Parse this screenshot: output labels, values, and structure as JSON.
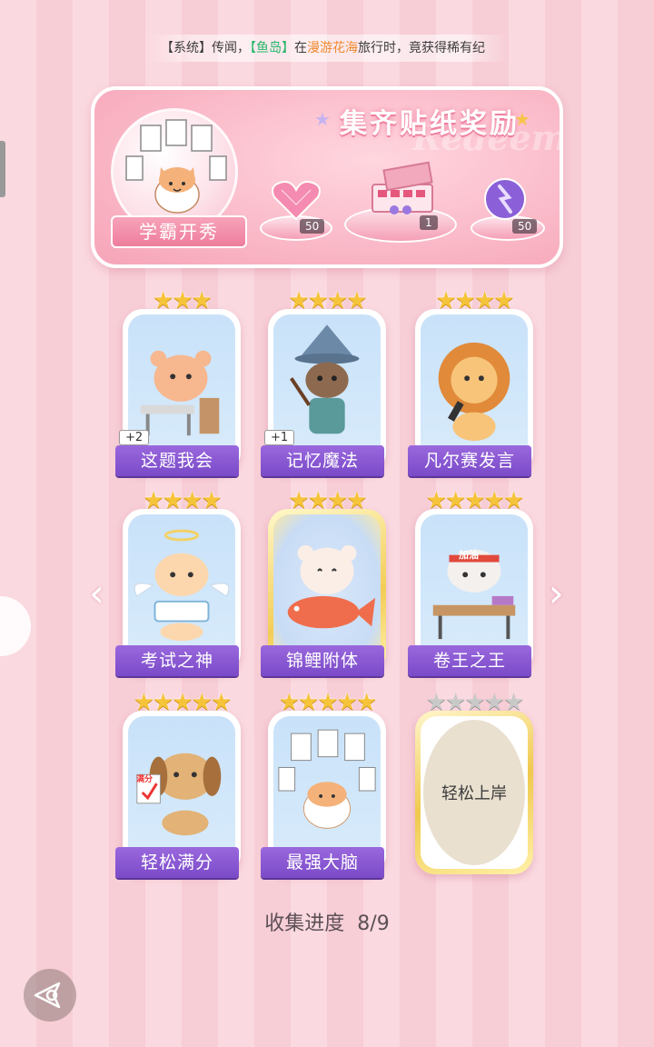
{
  "ticker": {
    "prefix": "【系统】传闻，",
    "player": "【鱼岛】",
    "mid": "在",
    "place": "漫游花海",
    "suffix": "旅行时，竟获得稀有纪"
  },
  "banner": {
    "title": "集齐贴纸奖励",
    "deco_word": "Redeem",
    "avatar_label": "学霸开秀",
    "rewards": [
      {
        "icon": "pink-heart-gem-icon",
        "count": "50"
      },
      {
        "icon": "gift-box-icon",
        "count": "1"
      },
      {
        "icon": "purple-orb-icon",
        "count": "50"
      }
    ]
  },
  "stickers": [
    {
      "label": "这题我会",
      "stars": 3,
      "plus": "+2",
      "icon": "bear-at-desk-icon",
      "gold": false
    },
    {
      "label": "记忆魔法",
      "stars": 4,
      "plus": "+1",
      "icon": "wizard-otter-icon",
      "gold": false
    },
    {
      "label": "凡尔赛发言",
      "stars": 4,
      "plus": "",
      "icon": "lion-microphone-icon",
      "gold": false
    },
    {
      "label": "考试之神",
      "stars": 4,
      "plus": "",
      "icon": "angel-cat-icon",
      "gold": false
    },
    {
      "label": "锦鲤附体",
      "stars": 4,
      "plus": "",
      "icon": "bear-koi-fish-icon",
      "gold": true
    },
    {
      "label": "卷王之王",
      "stars": 5,
      "plus": "",
      "icon": "studying-cat-icon",
      "gold": false,
      "headband": "加油"
    },
    {
      "label": "轻松满分",
      "stars": 5,
      "plus": "",
      "icon": "puppy-full-marks-icon",
      "gold": false,
      "paper": "满分"
    },
    {
      "label": "最强大脑",
      "stars": 5,
      "plus": "",
      "icon": "cat-with-papers-icon",
      "gold": false
    },
    {
      "label": "轻松上岸",
      "stars": 5,
      "plus": "",
      "icon": "locked-sticker-icon",
      "locked": true
    }
  ],
  "progress": {
    "label": "收集进度",
    "value": "8/9"
  },
  "colors": {
    "accent_purple": "#8a5ad6",
    "star_gold": "#f6c43a",
    "pink": "#f9b3c3"
  }
}
